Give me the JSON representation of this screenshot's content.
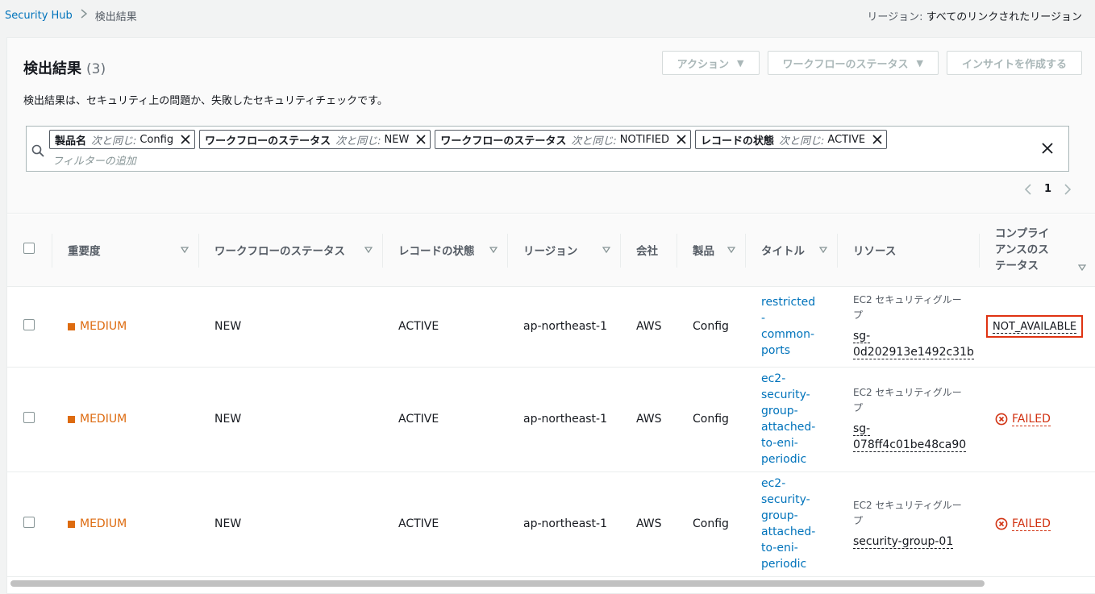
{
  "breadcrumb": {
    "root": "Security Hub",
    "current": "検出結果"
  },
  "region": {
    "label": "リージョン:",
    "value": "すべてのリンクされたリージョン"
  },
  "header": {
    "title": "検出結果",
    "count": "(3)",
    "description": "検出結果は、セキュリティ上の問題か、失敗したセキュリティチェックです。"
  },
  "actions": {
    "action_label": "アクション",
    "workflow_label": "ワークフローのステータス",
    "insight_label": "インサイトを作成する"
  },
  "filter": {
    "tokens": [
      {
        "key": "製品名",
        "op": "次と同じ:",
        "value": "Config"
      },
      {
        "key": "ワークフローのステータス",
        "op": "次と同じ:",
        "value": "NEW"
      },
      {
        "key": "ワークフローのステータス",
        "op": "次と同じ:",
        "value": "NOTIFIED"
      },
      {
        "key": "レコードの状態",
        "op": "次と同じ:",
        "value": "ACTIVE"
      }
    ],
    "placeholder": "フィルターの追加"
  },
  "pagination": {
    "page": "1"
  },
  "table": {
    "columns": {
      "severity": "重要度",
      "workflow": "ワークフローのステータス",
      "record": "レコードの状態",
      "region": "リージョン",
      "company": "会社",
      "product": "製品",
      "title": "タイトル",
      "resource": "リソース",
      "compliance": "コンプライアンスのステータス"
    },
    "rows": [
      {
        "severity": "MEDIUM",
        "workflow": "NEW",
        "record": "ACTIVE",
        "region": "ap-northeast-1",
        "company": "AWS",
        "product": "Config",
        "title": "restricted-common-ports",
        "resource_type": "EC2 セキュリティグループ",
        "resource_id": "sg-0d202913e1492c31b",
        "compliance": "NOT_AVAILABLE"
      },
      {
        "severity": "MEDIUM",
        "workflow": "NEW",
        "record": "ACTIVE",
        "region": "ap-northeast-1",
        "company": "AWS",
        "product": "Config",
        "title": "ec2-security-group-attached-to-eni-periodic",
        "resource_type": "EC2 セキュリティグループ",
        "resource_id": "sg-078ff4c01be48ca90",
        "compliance": "FAILED"
      },
      {
        "severity": "MEDIUM",
        "workflow": "NEW",
        "record": "ACTIVE",
        "region": "ap-northeast-1",
        "company": "AWS",
        "product": "Config",
        "title": "ec2-security-group-attached-to-eni-periodic",
        "resource_type": "EC2 セキュリティグループ",
        "resource_id": "security-group-01",
        "compliance": "FAILED"
      }
    ]
  },
  "colors": {
    "link": "#0073bb",
    "medium": "#dd6b10",
    "failed": "#d13212",
    "highlight": "#df3312"
  }
}
